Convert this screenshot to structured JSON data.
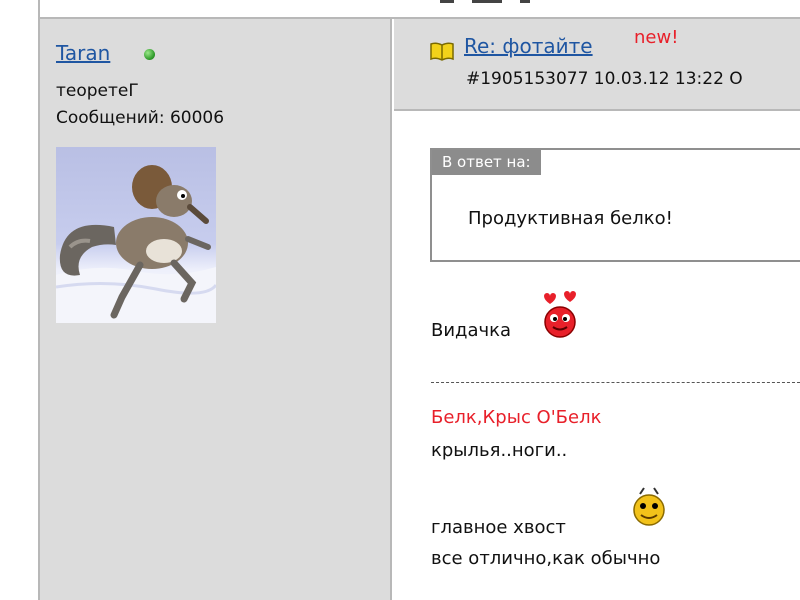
{
  "user": {
    "name": "Taran",
    "title": "теоретеГ",
    "posts_label": "Сообщений: 60006"
  },
  "post": {
    "subject": "Re: фотайте",
    "new_badge": "new!",
    "meta": "#1905153077 10.03.12 13:22  О"
  },
  "quote": {
    "label": "В ответ на:",
    "text": "Продуктивная белко!"
  },
  "body": {
    "line1": "Видачка",
    "line2": "Белк,Крыс О'Белк",
    "line3": "крылья..ноги..",
    "line4": "главное хвост",
    "line5": "все отлично,как обычно"
  },
  "colors": {
    "link": "#1f56a2",
    "accent_red": "#e8202a",
    "panel": "#dcdcdc"
  },
  "icons": [
    "online-status-icon",
    "book-icon",
    "love-smiley-icon",
    "yellow-smiley-icon"
  ]
}
